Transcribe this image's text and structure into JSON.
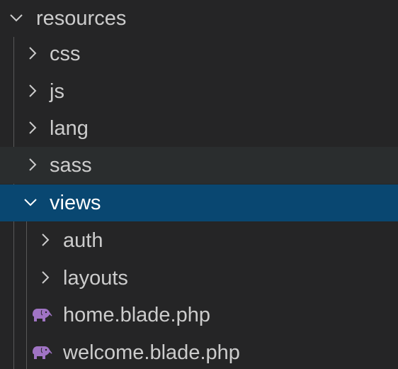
{
  "explorer": {
    "items": [
      {
        "label": "resources",
        "icon": "chevron-down-icon"
      },
      {
        "label": "css",
        "icon": "chevron-right-icon"
      },
      {
        "label": "js",
        "icon": "chevron-right-icon"
      },
      {
        "label": "lang",
        "icon": "chevron-right-icon"
      },
      {
        "label": "sass",
        "icon": "chevron-right-icon"
      },
      {
        "label": "views",
        "icon": "chevron-down-icon"
      },
      {
        "label": "auth",
        "icon": "chevron-right-icon"
      },
      {
        "label": "layouts",
        "icon": "chevron-right-icon"
      },
      {
        "label": "home.blade.php",
        "icon": "php-elephant-icon"
      },
      {
        "label": "welcome.blade.php",
        "icon": "php-elephant-icon"
      }
    ]
  },
  "colors": {
    "background": "#252526",
    "hover_row": "#2a2d2e",
    "selected_row": "#094771",
    "text": "#cccccc",
    "php_icon": "#a074c4",
    "indent_guide": "#585858"
  }
}
